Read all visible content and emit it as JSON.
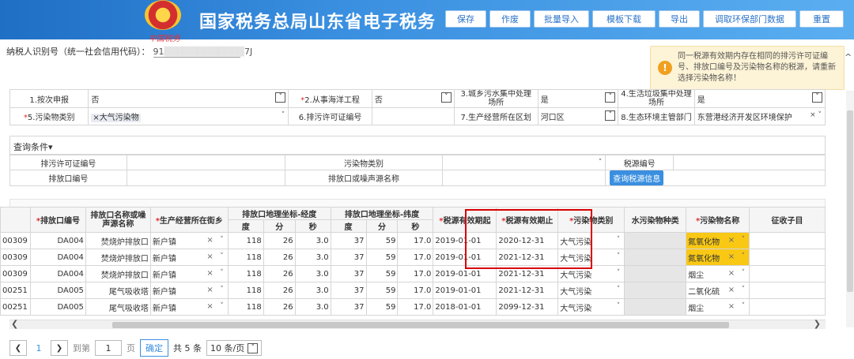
{
  "header": {
    "emblem_caption": "中国税务",
    "title": "国家税务总局山东省电子税务",
    "toolbar": [
      "保存",
      "作废",
      "批量导入",
      "模板下载",
      "导出",
      "调取环保部门数据",
      "重置"
    ]
  },
  "taxpayer": {
    "label": "纳税人识别号（统一社会信用代码）：",
    "value_prefix": "91",
    "value_suffix": "7J"
  },
  "notice": {
    "icon": "warning-icon",
    "text": "同一税源有效期内存在相同的排污许可证编号、排放口编号及污染物名称的税源，请重新选择污染物名称！"
  },
  "params": {
    "row1": [
      {
        "label": "1.按次申报",
        "value": "否",
        "required": false
      },
      {
        "label": "2.从事海洋工程",
        "value": "否",
        "required": true
      },
      {
        "label": "3.城乡污水集中处理场所",
        "value": "是",
        "required": false
      },
      {
        "label": "4.生活垃圾集中处理场所",
        "value": "是",
        "required": false
      }
    ],
    "row2": [
      {
        "label": "5.污染物类别",
        "value": "大气污染物",
        "required": true
      },
      {
        "label": "6.排污许可证编号",
        "value": "",
        "required": false
      },
      {
        "label": "7.生产经营所在区划",
        "value": "河口区",
        "required": false
      },
      {
        "label": "8.生态环境主管部门",
        "value": "东营港经济开发区环境保护",
        "required": false
      }
    ]
  },
  "query": {
    "title": "查询条件",
    "permit_label": "排污许可证编号",
    "pollutant_type_label": "污染物类别",
    "tax_source_label": "税源编号",
    "outlet_label": "排放口编号",
    "outlet_name_label": "排放口或噪声源名称",
    "search_button": "查询税源信息"
  },
  "grid": {
    "headers": {
      "outlet_no": "排放口编号",
      "outlet_name": "排放口名称或噪声源名称",
      "street": "生产经营所在街乡",
      "lng": "排放口地理坐标-经度",
      "lat": "排放口地理坐标-纬度",
      "deg": "度",
      "min": "分",
      "sec": "秒",
      "valid_from": "税源有效期起",
      "valid_to": "税源有效期止",
      "pollutant_type": "污染物类别",
      "water_type": "水污染物种类",
      "pollutant_name": "污染物名称",
      "levy": "征收子目"
    },
    "rows": [
      {
        "id": "00309",
        "outlet": "DA004",
        "name": "焚烧炉排放口",
        "street": "新户镇",
        "lng_d": "118",
        "lng_m": "26",
        "lng_s": "3.0",
        "lat_d": "37",
        "lat_m": "59",
        "lat_s": "17.0",
        "from": "2019-01-01",
        "to": "2020-12-31",
        "ptype": "大气污染",
        "pname": "氮氧化物",
        "hl": true
      },
      {
        "id": "00309",
        "outlet": "DA004",
        "name": "焚烧炉排放口",
        "street": "新户镇",
        "lng_d": "118",
        "lng_m": "26",
        "lng_s": "3.0",
        "lat_d": "37",
        "lat_m": "59",
        "lat_s": "17.0",
        "from": "2019-01-01",
        "to": "2021-12-31",
        "ptype": "大气污染",
        "pname": "氮氧化物",
        "hl": true
      },
      {
        "id": "00309",
        "outlet": "DA004",
        "name": "焚烧炉排放口",
        "street": "新户镇",
        "lng_d": "118",
        "lng_m": "26",
        "lng_s": "3.0",
        "lat_d": "37",
        "lat_m": "59",
        "lat_s": "17.0",
        "from": "2019-01-01",
        "to": "2021-12-31",
        "ptype": "大气污染",
        "pname": "烟尘",
        "hl": false
      },
      {
        "id": "00251",
        "outlet": "DA005",
        "name": "尾气吸收塔",
        "street": "新户镇",
        "lng_d": "118",
        "lng_m": "26",
        "lng_s": "3.0",
        "lat_d": "37",
        "lat_m": "59",
        "lat_s": "17.0",
        "from": "2019-01-01",
        "to": "2021-12-31",
        "ptype": "大气污染",
        "pname": "二氧化硫",
        "hl": false
      },
      {
        "id": "00251",
        "outlet": "DA005",
        "name": "尾气吸收塔",
        "street": "新户镇",
        "lng_d": "118",
        "lng_m": "26",
        "lng_s": "3.0",
        "lat_d": "37",
        "lat_m": "59",
        "lat_s": "17.0",
        "from": "2018-01-01",
        "to": "2099-12-31",
        "ptype": "大气污染",
        "pname": "烟尘",
        "hl": false
      }
    ]
  },
  "pager": {
    "page": "1",
    "goto_label": "到第",
    "page_input": "1",
    "page_unit": "页",
    "ok": "确定",
    "total": "共 5 条",
    "page_size": "10 条/页"
  },
  "colors": {
    "header": "#2a7fd4",
    "highlight": "#f9c814",
    "redbox": "#d80000",
    "link": "#3a8fe0"
  }
}
